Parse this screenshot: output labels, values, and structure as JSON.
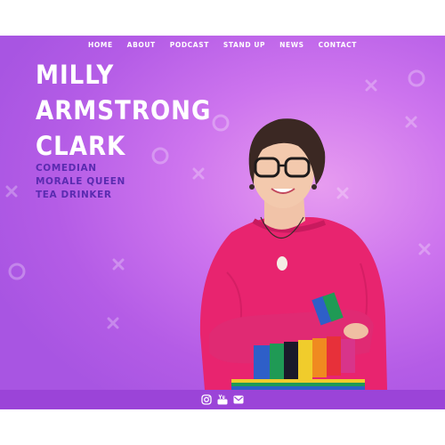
{
  "nav": {
    "items": [
      {
        "label": "HOME"
      },
      {
        "label": "ABOUT"
      },
      {
        "label": "PODCAST"
      },
      {
        "label": "STAND UP"
      },
      {
        "label": "NEWS"
      },
      {
        "label": "CONTACT"
      }
    ]
  },
  "hero": {
    "name_lines": [
      "MILLY",
      "ARMSTRONG",
      "CLARK"
    ],
    "tagline": [
      "COMEDIAN",
      "MORALE QUEEN",
      "TEA DRINKER"
    ]
  },
  "footer": {
    "social_icons": [
      "instagram-icon",
      "youtube-icon",
      "email-icon"
    ]
  },
  "colors": {
    "background_gradient": [
      "#e79cf0",
      "#b45ce6"
    ],
    "tagline": "#5a2bb0",
    "footer_bar": "#9b44d8",
    "text": "#ffffff"
  }
}
